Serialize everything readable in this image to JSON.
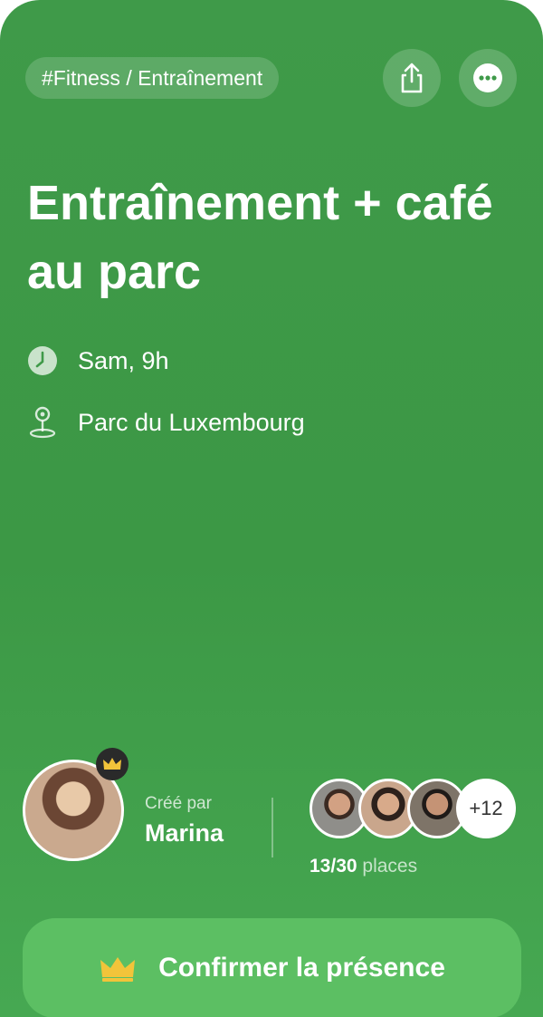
{
  "header": {
    "tag": "#Fitness / Entraînement",
    "share_icon": "share-icon",
    "more_icon": "more-icon"
  },
  "event": {
    "title": "Entraînement + café au parc",
    "time": "Sam, 9h",
    "location": "Parc du Luxembourg"
  },
  "creator": {
    "label": "Créé par",
    "name": "Marina"
  },
  "attendees": {
    "more_count": "+12",
    "places_count": "13/30",
    "places_label": "places"
  },
  "cta": {
    "label": "Confirmer la présence"
  },
  "colors": {
    "background": "#3f9a49",
    "button": "#5cbf63",
    "crown": "#f2c43a"
  }
}
